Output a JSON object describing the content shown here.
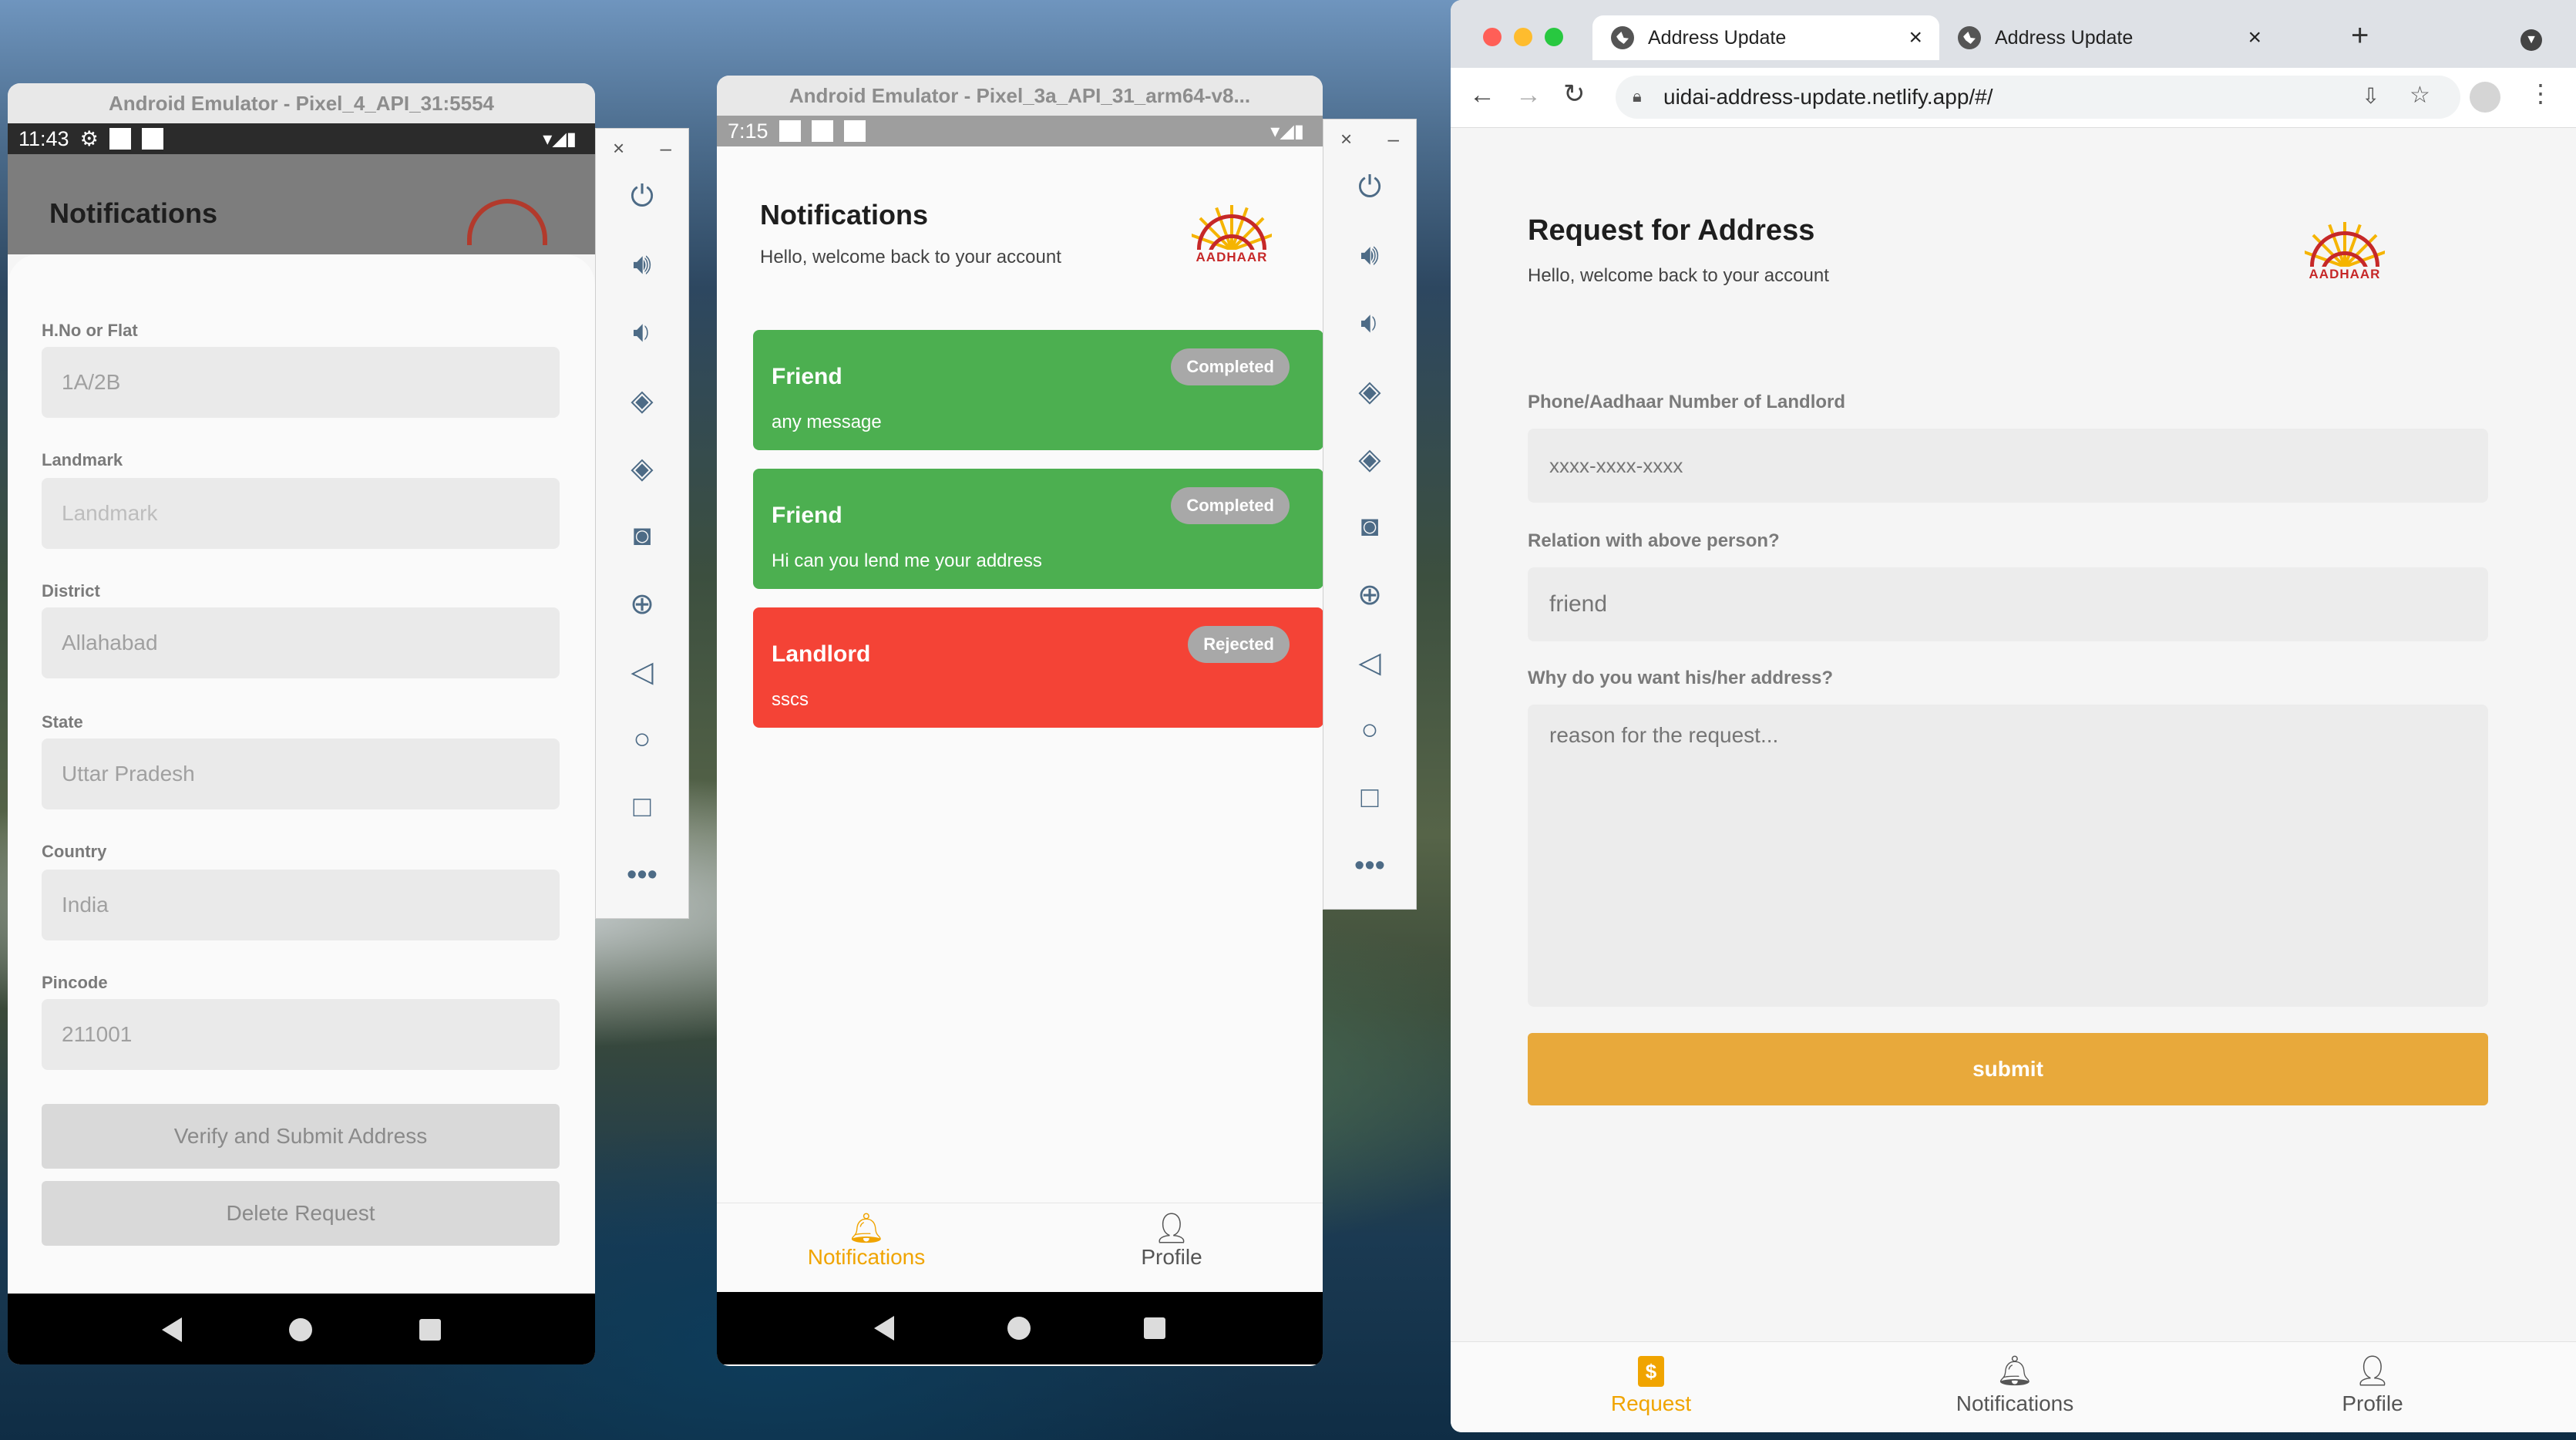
{
  "emulator1": {
    "title": "Android Emulator - Pixel_4_API_31:5554",
    "time": "11:43",
    "app_title": "Notifications",
    "fields": [
      {
        "label": "H.No or Flat",
        "value": "1A/2B"
      },
      {
        "label": "Landmark",
        "value": "Landmark"
      },
      {
        "label": "District",
        "value": "Allahabad"
      },
      {
        "label": "State",
        "value": "Uttar Pradesh"
      },
      {
        "label": "Country",
        "value": "India"
      },
      {
        "label": "Pincode",
        "value": "211001"
      }
    ],
    "verify_button": "Verify and Submit Address",
    "delete_button": "Delete Request"
  },
  "emulator2": {
    "title": "Android Emulator - Pixel_3a_API_31_arm64-v8...",
    "time": "7:15",
    "app_title": "Notifications",
    "subtitle": "Hello, welcome back to your account",
    "logo_text": "AADHAAR",
    "cards": [
      {
        "name": "Friend",
        "message": "any message",
        "status": "Completed",
        "color": "#4caf50"
      },
      {
        "name": "Friend",
        "message": "Hi can you lend me your address",
        "status": "Completed",
        "color": "#4caf50"
      },
      {
        "name": "Landlord",
        "message": "sscs",
        "status": "Rejected",
        "color": "#f44336"
      }
    ],
    "bottom_nav": [
      {
        "label": "Notifications",
        "icon": "bell-icon",
        "active": true
      },
      {
        "label": "Profile",
        "icon": "person-icon",
        "active": false
      }
    ]
  },
  "emulator_controls": {
    "close": "×",
    "minimize": "–",
    "icons": [
      "power-icon",
      "volume-up-icon",
      "volume-down-icon",
      "rotate-left-icon",
      "rotate-right-icon",
      "camera-icon",
      "zoom-icon",
      "back-icon",
      "home-icon",
      "overview-icon",
      "more-icon"
    ]
  },
  "browser": {
    "tabs": [
      {
        "label": "Address Update",
        "active": true
      },
      {
        "label": "Address Update",
        "active": false
      }
    ],
    "url": "uidai-address-update.netlify.app/#/",
    "page": {
      "title": "Request for Address",
      "subtitle": "Hello, welcome back to your account",
      "logo_text": "AADHAAR",
      "fields": [
        {
          "label": "Phone/Aadhaar Number of Landlord",
          "placeholder": "xxxx-xxxx-xxxx"
        },
        {
          "label": "Relation with above person?",
          "placeholder": "friend"
        },
        {
          "label": "Why do you want his/her address?",
          "placeholder": "reason for the request..."
        }
      ],
      "submit": "submit",
      "accent": "#e8a93b"
    },
    "bottom_nav": [
      {
        "label": "Request",
        "icon": "rupee-doc-icon",
        "active": true
      },
      {
        "label": "Notifications",
        "icon": "bell-icon",
        "active": false
      },
      {
        "label": "Profile",
        "icon": "person-icon",
        "active": false
      }
    ]
  }
}
